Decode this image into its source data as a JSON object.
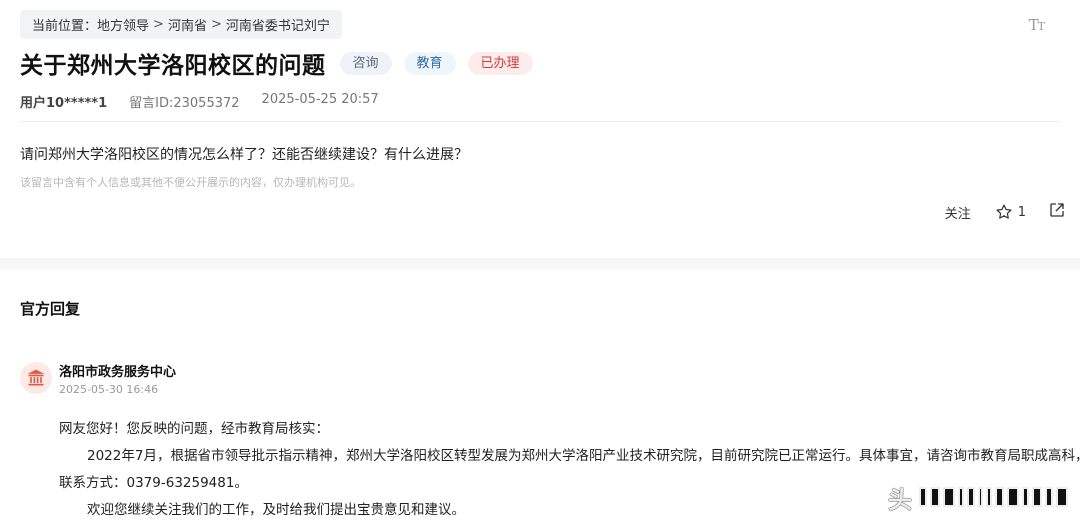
{
  "breadcrumb": {
    "label": "当前位置：",
    "items": [
      "地方领导",
      "河南省",
      "河南省委书记刘宁"
    ],
    "separator": ">"
  },
  "toolbar": {
    "font_size_icon": "font-size-icon"
  },
  "message": {
    "title": "关于郑州大学洛阳校区的问题",
    "tags": [
      "咨询",
      "教育",
      "已办理"
    ],
    "user": "用户10*****1",
    "message_id": "留言ID:23055372",
    "datetime": "2025-05-25 20:57",
    "question": "请问郑州大学洛阳校区的情况怎么样了？还能否继续建设？有什么进展？",
    "privacy_notice": "该留言中含有个人信息或其他不便公开展示的内容，仅办理机构可见。"
  },
  "actions": {
    "follow_label": "关注",
    "favorite_count": "1",
    "icons": [
      "star-icon",
      "share-icon"
    ]
  },
  "reply_section": {
    "title": "官方回复",
    "organization": "洛阳市政务服务中心",
    "reply_time": "2025-05-30 16:46",
    "paragraphs": [
      "网友您好！您反映的问题，经市教育局核实：",
      "2022年7月，根据省市领导批示指示精神，郑州大学洛阳校区转型发展为郑州大学洛阳产业技术研究院，目前研究院已正常运行。具体事宜，请咨询市教育局职成高科，",
      "联系方式：0379-63259481。",
      "欢迎您继续关注我们的工作，及时给我们提出宝贵意见和建议。"
    ]
  },
  "watermark": {
    "text": "头"
  },
  "colors": {
    "tag_consult_text": "#5b6b82",
    "tag_edu_text": "#2f6aa5",
    "tag_done_text": "#d23b3b",
    "avatar_icon": "#e05a45"
  }
}
